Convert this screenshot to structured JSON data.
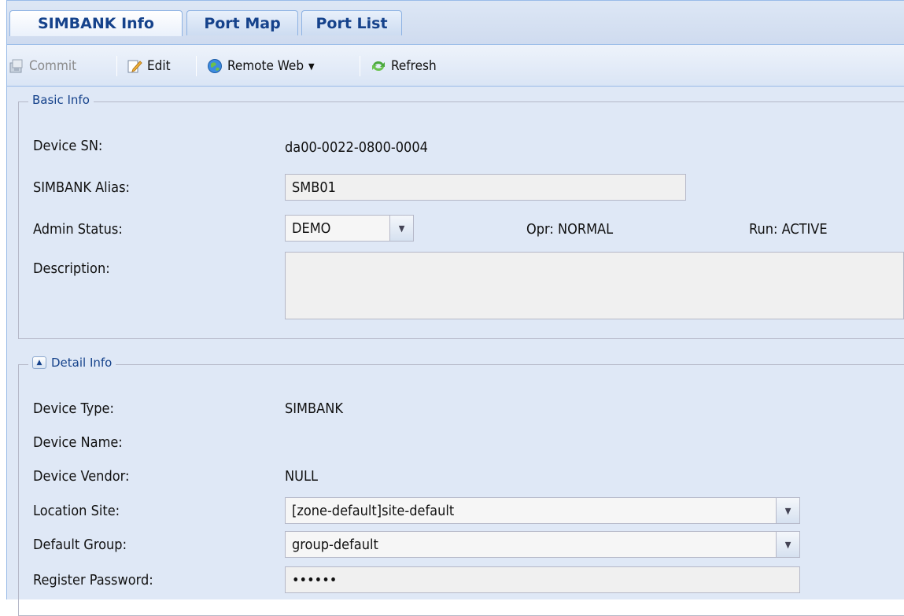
{
  "tabs": [
    {
      "label": "SIMBANK Info",
      "active": true
    },
    {
      "label": "Port Map",
      "active": false
    },
    {
      "label": "Port List",
      "active": false
    }
  ],
  "toolbar": {
    "commit_label": "Commit",
    "edit_label": "Edit",
    "remote_web_label": "Remote Web",
    "refresh_label": "Refresh"
  },
  "basic_info": {
    "legend": "Basic Info",
    "device_sn_label": "Device SN:",
    "device_sn_value": "da00-0022-0800-0004",
    "alias_label": "SIMBANK Alias:",
    "alias_value": "SMB01",
    "admin_status_label": "Admin Status:",
    "admin_status_value": "DEMO",
    "opr_status": "Opr: NORMAL",
    "run_status": "Run: ACTIVE",
    "description_label": "Description:",
    "description_value": ""
  },
  "detail_info": {
    "legend": "Detail Info",
    "device_type_label": "Device Type:",
    "device_type_value": "SIMBANK",
    "device_name_label": "Device Name:",
    "device_name_value": "",
    "device_vendor_label": "Device Vendor:",
    "device_vendor_value": "NULL",
    "location_site_label": "Location Site:",
    "location_site_value": "[zone-default]site-default",
    "default_group_label": "Default Group:",
    "default_group_value": "group-default",
    "register_password_label": "Register Password:",
    "register_password_value": "••••••"
  },
  "colors": {
    "panel_bg": "#dfe8f6",
    "tab_text": "#15428b",
    "border": "#99bbe8"
  }
}
